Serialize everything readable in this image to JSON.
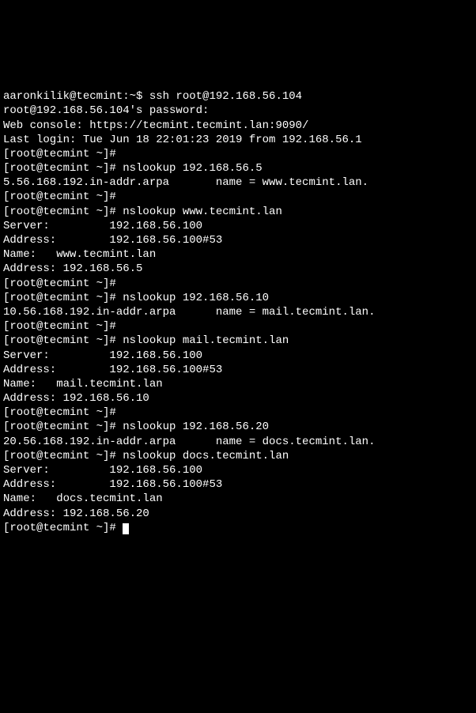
{
  "lines": [
    "aaronkilik@tecmint:~$ ssh root@192.168.56.104",
    "root@192.168.56.104's password:",
    "Web console: https://tecmint.tecmint.lan:9090/",
    "",
    "Last login: Tue Jun 18 22:01:23 2019 from 192.168.56.1",
    "[root@tecmint ~]#",
    "[root@tecmint ~]# nslookup 192.168.56.5",
    "5.56.168.192.in-addr.arpa       name = www.tecmint.lan.",
    "",
    "[root@tecmint ~]#",
    "[root@tecmint ~]# nslookup www.tecmint.lan",
    "Server:         192.168.56.100",
    "Address:        192.168.56.100#53",
    "",
    "Name:   www.tecmint.lan",
    "Address: 192.168.56.5",
    "",
    "[root@tecmint ~]#",
    "[root@tecmint ~]# nslookup 192.168.56.10",
    "10.56.168.192.in-addr.arpa      name = mail.tecmint.lan.",
    "",
    "[root@tecmint ~]#",
    "[root@tecmint ~]# nslookup mail.tecmint.lan",
    "Server:         192.168.56.100",
    "Address:        192.168.56.100#53",
    "",
    "Name:   mail.tecmint.lan",
    "Address: 192.168.56.10",
    "",
    "[root@tecmint ~]#",
    "[root@tecmint ~]# nslookup 192.168.56.20",
    "20.56.168.192.in-addr.arpa      name = docs.tecmint.lan.",
    "",
    "[root@tecmint ~]# nslookup docs.tecmint.lan",
    "Server:         192.168.56.100",
    "Address:        192.168.56.100#53",
    "",
    "Name:   docs.tecmint.lan",
    "Address: 192.168.56.20",
    "",
    "[root@tecmint ~]# "
  ],
  "cursor_line_index": 40
}
